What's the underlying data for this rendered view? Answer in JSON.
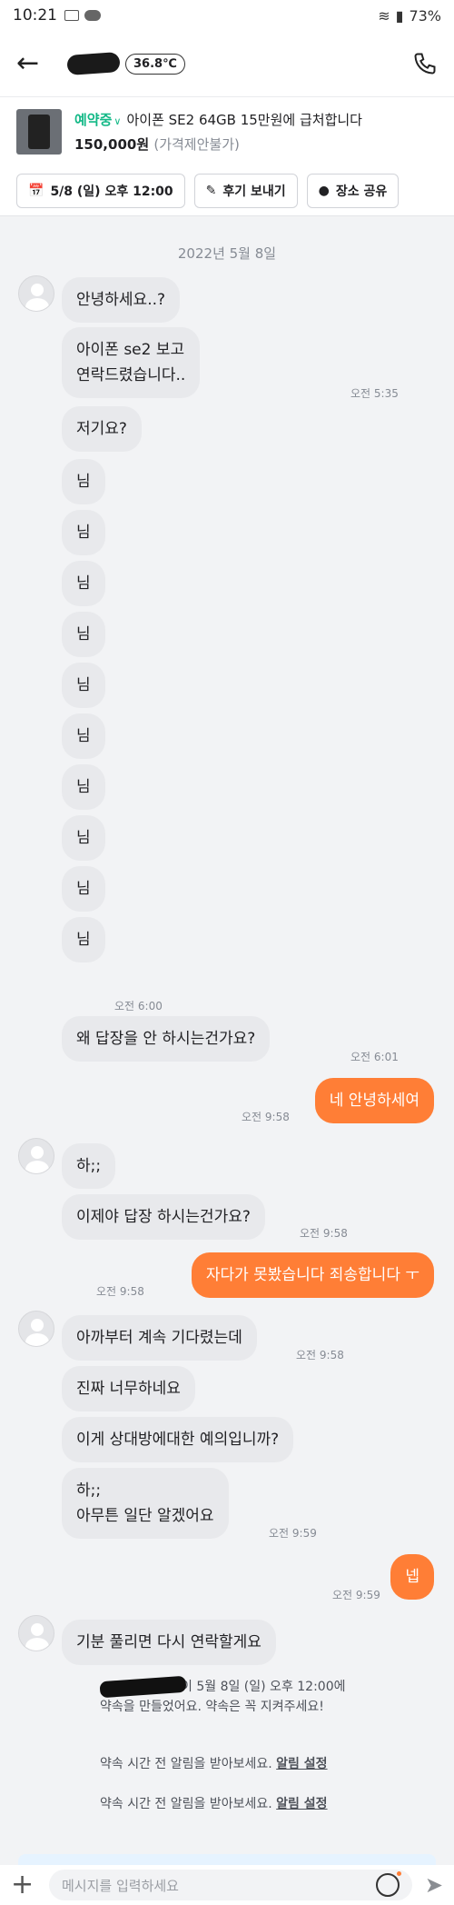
{
  "status_bar": {
    "time": "10:21",
    "battery": "73%"
  },
  "header": {
    "back_icon": "←",
    "temperature": "36.8℃"
  },
  "product": {
    "status": "예약중",
    "title": "아이폰 SE2 64GB 15만원에 급처합니다",
    "price": "150,000원",
    "negotiation": "(가격제안불가)"
  },
  "actions": [
    {
      "icon": "📅",
      "label": "5/8 (일) 오후 12:00"
    },
    {
      "icon": "✎",
      "label": "후기 보내기"
    },
    {
      "icon": "●",
      "label": "장소 공유"
    }
  ],
  "date_separator": "2022년 5월 8일",
  "messages": [
    {
      "text": "안녕하세요..?"
    },
    {
      "text": "아이폰 se2 보고\n연락드렸습니다..",
      "time": "오전 5:35"
    },
    {
      "text": "저기요?"
    },
    {
      "text": "님"
    },
    {
      "text": "님"
    },
    {
      "text": "님"
    },
    {
      "text": "님"
    },
    {
      "text": "님"
    },
    {
      "text": "님"
    },
    {
      "text": "님"
    },
    {
      "text": "님"
    },
    {
      "text": "님"
    },
    {
      "text": "님",
      "time": "오전 6:00"
    },
    {
      "text": "왜 답장을 안 하시는건가요?",
      "time": "오전 6:01"
    },
    {
      "text": "네 안녕하세여",
      "time": "오전 9:58"
    },
    {
      "text": "하;;"
    },
    {
      "text": "이제야 답장 하시는건가요?",
      "time": "오전 9:58"
    },
    {
      "text": "자다가 못봤습니다 죄송합니다 ㅜ",
      "time": "오전 9:58"
    },
    {
      "text": "아까부터 계속 기다렸는데",
      "time": "오전 9:58"
    },
    {
      "text": "진짜 너무하네요"
    },
    {
      "text": "이게 상대방에대한 예의입니까?"
    },
    {
      "text": "하;;\n아무튼 일단 알겠어요",
      "time": "오전 9:59"
    },
    {
      "text": "넵",
      "time": "오전 9:59"
    },
    {
      "text": "기분 풀리면 다시 연락할게요"
    }
  ],
  "system_messages": {
    "appointment_line1": "이 5월 8일 (일) 오후 12:00에",
    "appointment_line2": "약속을 만들었어요. 약속은 꼭 지켜주세요!",
    "reminder_text": "약속 시간 전 알림을 받아보세요.",
    "reminder_link": "알림 설정"
  },
  "input": {
    "plus_icon": "+",
    "placeholder": "메시지를 입력하세요",
    "send_icon": "➤"
  },
  "colors": {
    "accent": "#ff7e36",
    "reserved": "#12b886"
  }
}
